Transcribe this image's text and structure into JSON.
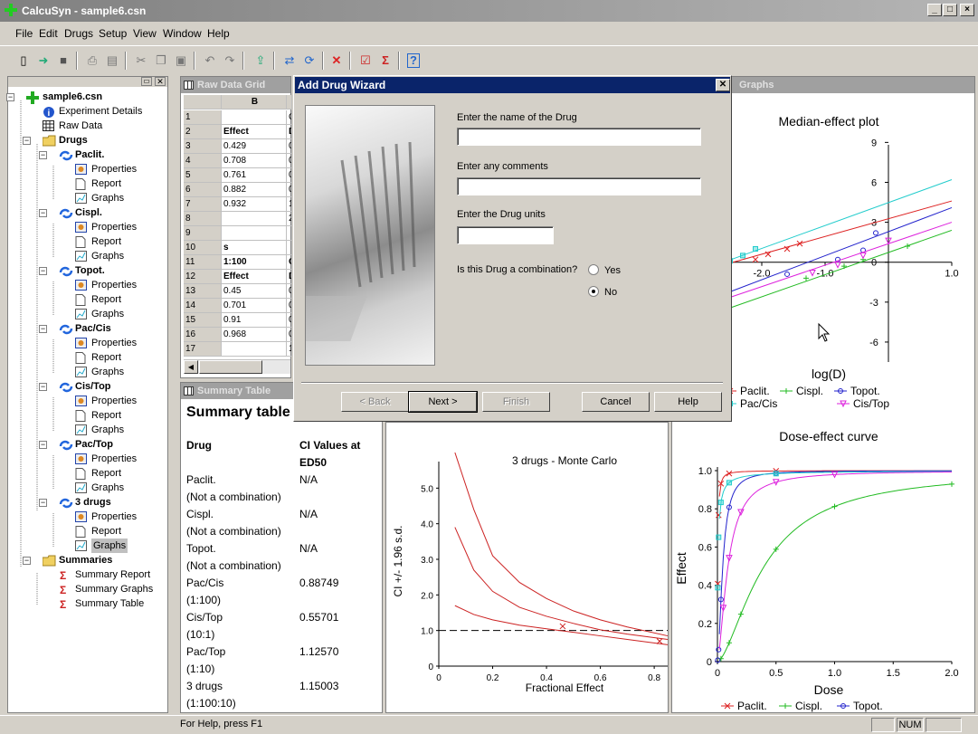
{
  "window": {
    "title": "CalcuSyn - sample6.csn",
    "min": "_",
    "max": "□",
    "close": "×"
  },
  "menu": [
    "File",
    "Edit",
    "Drugs",
    "Setup",
    "View",
    "Window",
    "Help"
  ],
  "toolbar": {
    "icons": [
      "new-icon",
      "open-icon",
      "save-icon",
      "print-icon",
      "preview-icon",
      "cut-icon",
      "copy-icon",
      "paste-icon",
      "undo-icon",
      "redo-icon",
      "export-icon",
      "refresh-icon",
      "sync-icon",
      "delete-icon",
      "check-icon",
      "sigma-icon",
      "help-icon"
    ]
  },
  "tree": {
    "root": "sample6.csn",
    "experiment": "Experiment Details",
    "raw": "Raw Data",
    "drugs": "Drugs",
    "groups": [
      {
        "name": "Paclit.",
        "children": [
          "Properties",
          "Report",
          "Graphs"
        ]
      },
      {
        "name": "Cispl.",
        "children": [
          "Properties",
          "Report",
          "Graphs"
        ]
      },
      {
        "name": "Topot.",
        "children": [
          "Properties",
          "Report",
          "Graphs"
        ]
      },
      {
        "name": "Pac/Cis",
        "children": [
          "Properties",
          "Report",
          "Graphs"
        ]
      },
      {
        "name": "Cis/Top",
        "children": [
          "Properties",
          "Report",
          "Graphs"
        ]
      },
      {
        "name": "Pac/Top",
        "children": [
          "Properties",
          "Report",
          "Graphs"
        ]
      },
      {
        "name": "3 drugs",
        "children": [
          "Properties",
          "Report",
          "Graphs"
        ]
      }
    ],
    "summaries": "Summaries",
    "summary_items": [
      "Summary Report",
      "Summary Graphs",
      "Summary Table"
    ]
  },
  "rawgrid": {
    "title": "Raw Data Grid",
    "col_b": "B",
    "rows": [
      {
        "n": "1",
        "b": "",
        "c": "C"
      },
      {
        "n": "2",
        "b": "Effect",
        "c": "D"
      },
      {
        "n": "3",
        "b": "0.429",
        "c": "0"
      },
      {
        "n": "4",
        "b": "0.708",
        "c": "0"
      },
      {
        "n": "5",
        "b": "0.761",
        "c": "0"
      },
      {
        "n": "6",
        "b": "0.882",
        "c": "0"
      },
      {
        "n": "7",
        "b": "0.932",
        "c": "1"
      },
      {
        "n": "8",
        "b": "",
        "c": "2"
      },
      {
        "n": "9",
        "b": "",
        "c": ""
      },
      {
        "n": "10",
        "b": "s",
        "c": ""
      },
      {
        "n": "11",
        "b": "1:100",
        "c": "C"
      },
      {
        "n": "12",
        "b": "Effect",
        "c": "D"
      },
      {
        "n": "13",
        "b": "0.45",
        "c": "0"
      },
      {
        "n": "14",
        "b": "0.701",
        "c": "0"
      },
      {
        "n": "15",
        "b": "0.91",
        "c": "0"
      },
      {
        "n": "16",
        "b": "0.968",
        "c": "0"
      },
      {
        "n": "17",
        "b": "",
        "c": "1"
      }
    ]
  },
  "summary": {
    "header": "Summary Table",
    "title": "Summary table",
    "col_drug": "Drug",
    "col_ci_1": "CI Values at",
    "col_ci_2": "ED50",
    "rows": [
      {
        "name": "Paclit.",
        "sub": "(Not a combination)",
        "val": "N/A"
      },
      {
        "name": "Cispl.",
        "sub": "(Not a combination)",
        "val": "N/A"
      },
      {
        "name": "Topot.",
        "sub": "(Not a combination)",
        "val": "N/A"
      },
      {
        "name": "Pac/Cis",
        "sub": "(1:100)",
        "val": "0.88749"
      },
      {
        "name": "Cis/Top",
        "sub": "(10:1)",
        "val": "0.55701"
      },
      {
        "name": "Pac/Top",
        "sub": "(1:10)",
        "val": "1.12570"
      },
      {
        "name": "3 drugs",
        "sub": "(1:100:10)",
        "val": "1.15003"
      }
    ]
  },
  "dialog": {
    "title": "Add Drug Wizard",
    "name_label": "Enter the name of the Drug",
    "name_value": "",
    "comments_label": "Enter any comments",
    "comments_value": "",
    "units_label": "Enter the Drug units",
    "units_value": "",
    "combo_label": "Is this Drug a combination?",
    "yes": "Yes",
    "no": "No",
    "selected": "No",
    "back": "< Back",
    "next": "Next >",
    "finish": "Finish",
    "cancel": "Cancel",
    "help": "Help"
  },
  "graphs_header": "Graphs",
  "status": {
    "help": "For Help, press F1",
    "num": "NUM"
  },
  "colors": {
    "paclit": "#dd2222",
    "cispl": "#22bb22",
    "topot": "#2222cc",
    "paccis": "#22cccc",
    "cistop": "#dd22dd",
    "mc": "#cc2222"
  },
  "chart_data": [
    {
      "type": "line",
      "title": "Median-effect plot",
      "xlabel": "log(D)",
      "ylabel": "",
      "xlim": [
        -2.6,
        1.0
      ],
      "ylim": [
        -7.5,
        9.5
      ],
      "xticks": [
        -2.0,
        -1.0,
        0.0,
        1.0
      ],
      "xtick_labels": [
        "-2.0",
        "-1.0",
        "",
        "1.0"
      ],
      "yticks": [
        9,
        6,
        3,
        0,
        -3,
        -6
      ],
      "series": [
        {
          "name": "Paclit.",
          "color": "#dd2222",
          "x": [
            -2.6,
            1.0
          ],
          "y": [
            -0.2,
            4.6
          ],
          "points": [
            [
              -2.1,
              0.2
            ],
            [
              -1.9,
              0.6
            ],
            [
              -1.6,
              1.0
            ],
            [
              -1.4,
              1.4
            ]
          ]
        },
        {
          "name": "Cispl.",
          "color": "#22bb22",
          "x": [
            -2.6,
            1.0
          ],
          "y": [
            -3.6,
            2.4
          ],
          "points": [
            [
              -1.3,
              -1.2
            ],
            [
              -0.7,
              -0.3
            ],
            [
              -0.4,
              0.2
            ],
            [
              0.3,
              1.2
            ]
          ]
        },
        {
          "name": "Topot.",
          "color": "#2222cc",
          "x": [
            -2.6,
            1.0
          ],
          "y": [
            -2.4,
            4.1
          ],
          "points": [
            [
              -1.6,
              -0.9
            ],
            [
              -0.8,
              0.2
            ],
            [
              -0.4,
              0.9
            ],
            [
              -0.2,
              2.2
            ]
          ]
        },
        {
          "name": "Pac/Cis",
          "color": "#22cccc",
          "x": [
            -2.6,
            1.0
          ],
          "y": [
            0.0,
            6.2
          ],
          "points": [
            [
              -2.5,
              0.1
            ],
            [
              -2.3,
              0.5
            ],
            [
              -2.1,
              1.0
            ]
          ]
        },
        {
          "name": "Cis/Top",
          "color": "#dd22dd",
          "x": [
            -2.6,
            1.0
          ],
          "y": [
            -2.8,
            3.0
          ],
          "points": [
            [
              -1.2,
              -0.8
            ],
            [
              -0.8,
              -0.2
            ],
            [
              -0.4,
              0.5
            ],
            [
              0.0,
              1.6
            ]
          ]
        }
      ]
    },
    {
      "type": "line",
      "title": "3 drugs - Monte Carlo",
      "xlabel": "Fractional Effect",
      "ylabel": "CI +/- 1.96 s.d.",
      "xlim": [
        0,
        0.85
      ],
      "ylim": [
        0,
        6.0
      ],
      "xticks": [
        0,
        0.2,
        0.4,
        0.6,
        0.8
      ],
      "yticks": [
        0,
        1.0,
        2.0,
        3.0,
        4.0,
        5.0
      ],
      "reference_line": 1.0,
      "series": [
        {
          "name": "upper",
          "x": [
            0.06,
            0.13,
            0.2,
            0.3,
            0.4,
            0.5,
            0.6,
            0.7,
            0.85
          ],
          "y": [
            6.0,
            4.4,
            3.1,
            2.35,
            1.9,
            1.55,
            1.3,
            1.1,
            0.85
          ]
        },
        {
          "name": "mid",
          "x": [
            0.06,
            0.13,
            0.2,
            0.3,
            0.4,
            0.5,
            0.6,
            0.7,
            0.85
          ],
          "y": [
            3.9,
            2.7,
            2.1,
            1.65,
            1.4,
            1.2,
            1.02,
            0.9,
            0.75
          ]
        },
        {
          "name": "lower",
          "x": [
            0.06,
            0.13,
            0.2,
            0.3,
            0.4,
            0.5,
            0.6,
            0.7,
            0.85
          ],
          "y": [
            1.7,
            1.45,
            1.3,
            1.15,
            1.05,
            0.95,
            0.85,
            0.75,
            0.6
          ]
        }
      ],
      "markers": [
        [
          0.46,
          1.12
        ],
        [
          0.82,
          0.7
        ]
      ]
    },
    {
      "type": "line",
      "title": "Dose-effect curve",
      "xlabel": "Dose",
      "ylabel": "Effect",
      "xlim": [
        0,
        2.0
      ],
      "ylim": [
        0,
        1.0
      ],
      "xticks": [
        0,
        0.5,
        1.0,
        1.5,
        2.0
      ],
      "xtick_labels": [
        "0",
        "0.5",
        "1.0",
        "1.5",
        "2.0"
      ],
      "yticks": [
        0,
        0.2,
        0.4,
        0.6,
        0.8,
        1.0
      ],
      "ytick_labels": [
        "0",
        "0.2",
        "0.4",
        "0.6",
        "0.8",
        "1.0"
      ],
      "series": [
        {
          "name": "Paclit.",
          "color": "#dd2222",
          "dm": 0.004,
          "m": 1.3
        },
        {
          "name": "Cispl.",
          "color": "#22bb22",
          "dm": 0.4,
          "m": 1.6
        },
        {
          "name": "Topot.",
          "color": "#2222cc",
          "dm": 0.045,
          "m": 1.8
        },
        {
          "name": "Pac/Cis",
          "color": "#22cccc",
          "dm": 0.005,
          "m": 0.9
        },
        {
          "name": "Cis/Top",
          "color": "#dd22dd",
          "dm": 0.09,
          "m": 1.6
        }
      ],
      "legend": [
        "Paclit.",
        "Cispl.",
        "Topot."
      ]
    }
  ],
  "legend_top": [
    "Paclit.",
    "Cispl.",
    "Topot.",
    "Pac/Cis",
    "Cis/Top"
  ]
}
